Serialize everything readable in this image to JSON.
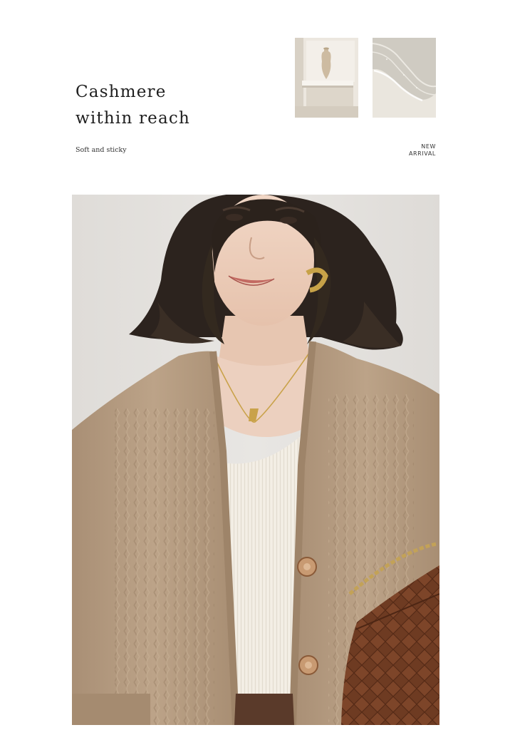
{
  "header": {
    "headline_line1": "Cashmere",
    "headline_line2": "within reach",
    "tagline": "Soft and sticky",
    "badge_line1": "NEW",
    "badge_line2": "ARRIVAL"
  },
  "colors": {
    "background": "#ffffff",
    "sweater": "#b39a80",
    "camisole": "#f1ece2",
    "backdrop": "#e4e2df",
    "bag": "#6b3a22"
  }
}
